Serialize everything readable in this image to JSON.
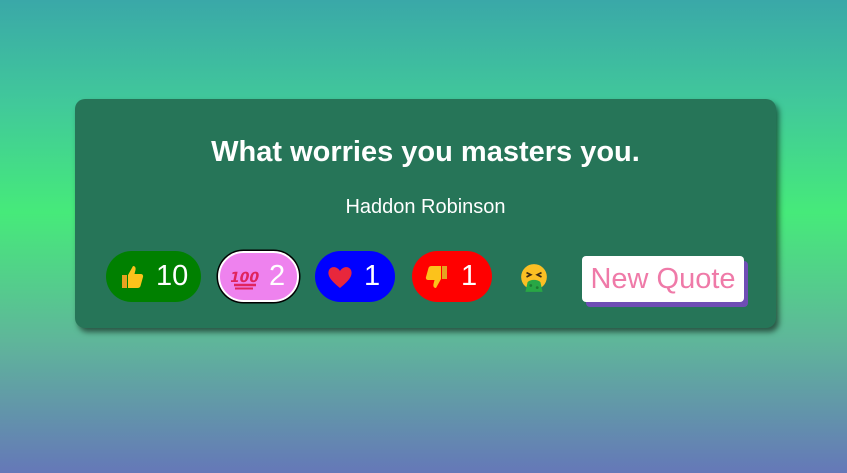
{
  "quote": {
    "text": "What worries you masters you.",
    "author": "Haddon Robinson"
  },
  "reactions": [
    {
      "name": "thumbs-up",
      "emoji": "👍",
      "count": "10",
      "color": "#008000"
    },
    {
      "name": "hundred",
      "emoji": "💯",
      "count": "2",
      "color": "#ee82ee"
    },
    {
      "name": "heart",
      "emoji": "❤️",
      "count": "1",
      "color": "#0000ff"
    },
    {
      "name": "thumbs-down",
      "emoji": "👎",
      "count": "1",
      "color": "#ff0000"
    },
    {
      "name": "face-vomiting",
      "emoji": "🤮"
    }
  ],
  "new_quote_label": "New Quote",
  "colors": {
    "card": "#267558",
    "button_text": "#ef7aa8",
    "button_shadow": "#6f4db5"
  }
}
